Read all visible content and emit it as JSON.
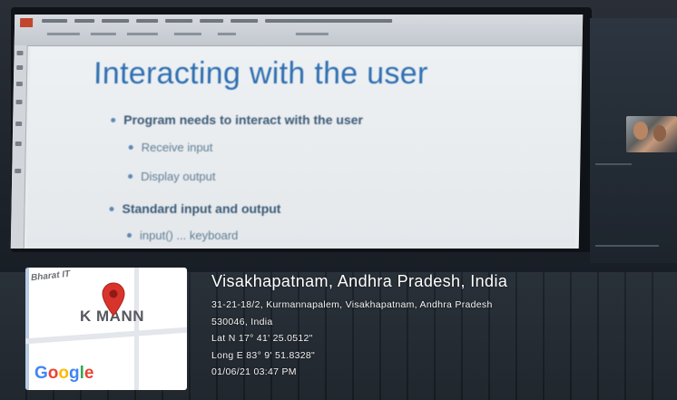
{
  "slide": {
    "title": "Interacting with the user",
    "bullets": [
      {
        "level": 1,
        "text": "Program needs to interact with the user"
      },
      {
        "level": 2,
        "text": "Receive input"
      },
      {
        "level": 2,
        "text": "Display output"
      },
      {
        "level": 1,
        "text": "Standard input and output"
      },
      {
        "level": 2,
        "text": "input() ... keyboard"
      }
    ]
  },
  "map": {
    "place_label": "Bharat IT",
    "brand": "K  MANN",
    "logo_letters": [
      "G",
      "o",
      "o",
      "g",
      "l",
      "e"
    ],
    "pin_color": "#d9342b"
  },
  "location": {
    "city": "Visakhapatnam, Andhra Pradesh, India",
    "address_line1": "31-21-18/2, Kurmannapalem, Visakhapatnam, Andhra Pradesh",
    "address_line2": "530046, India",
    "latitude": "Lat N 17° 41' 25.0512\"",
    "longitude": "Long E 83° 9' 51.8328\"",
    "timestamp": "01/06/21 03:47 PM"
  },
  "icons": {
    "map_pin": "map-pin-icon",
    "google_logo": "google-logo"
  }
}
